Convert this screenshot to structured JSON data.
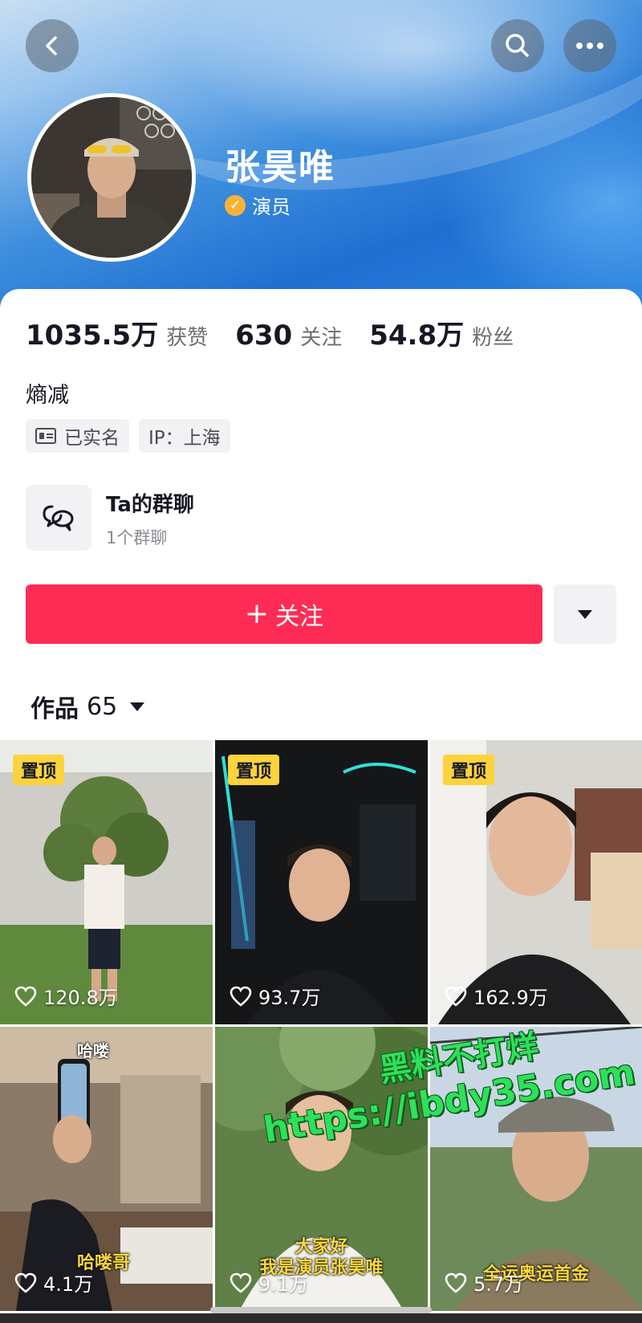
{
  "profile": {
    "name": "张昊唯",
    "verified_label": "演员",
    "bio": "熵减"
  },
  "stats": [
    {
      "value": "1035.5万",
      "label": "获赞"
    },
    {
      "value": "630",
      "label": "关注"
    },
    {
      "value": "54.8万",
      "label": "粉丝"
    }
  ],
  "tags": {
    "realname": "已实名",
    "ip": "IP：上海"
  },
  "group_chat": {
    "title": "Ta的群聊",
    "subtitle": "1个群聊"
  },
  "actions": {
    "follow_label": "关注",
    "follow_plus": "+"
  },
  "works": {
    "label": "作品",
    "count": "65"
  },
  "videos": [
    {
      "pinned": "置顶",
      "likes": "120.8万",
      "caption": ""
    },
    {
      "pinned": "置顶",
      "likes": "93.7万",
      "caption": ""
    },
    {
      "pinned": "置顶",
      "likes": "162.9万",
      "caption": ""
    },
    {
      "pinned": "",
      "likes": "4.1万",
      "caption_top": "哈喽",
      "caption": "哈喽哥"
    },
    {
      "pinned": "",
      "likes": "9.1万",
      "caption": "大家好\n我是演员张昊唯"
    },
    {
      "pinned": "",
      "likes": "5.7万",
      "caption": "全运奥运首金"
    }
  ],
  "watermark": {
    "line1": "黑料不打烊",
    "line2": "https://ibdy35.com"
  },
  "colors": {
    "follow_button": "#fe2c55",
    "pin_badge": "#fcd33c",
    "verified": "#f6b336",
    "watermark": "#2fe05a"
  },
  "icons": {
    "back": "chevron-left-icon",
    "search": "search-icon",
    "more": "more-dots-icon",
    "group": "chat-bubbles-icon",
    "like": "heart-icon"
  }
}
